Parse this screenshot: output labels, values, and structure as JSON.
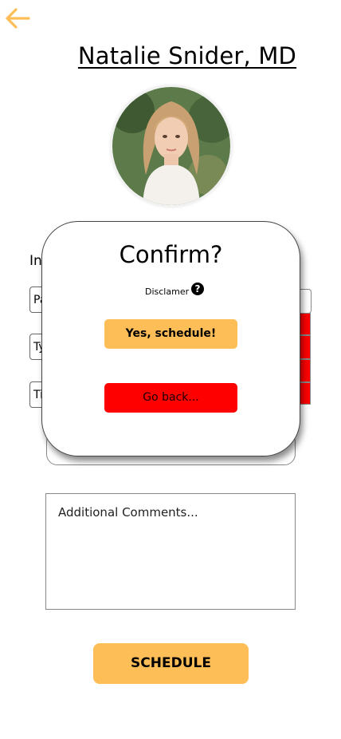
{
  "header": {
    "back_icon": "arrow-left-icon",
    "doctor_name": "Natalie Snider, MD",
    "accent_color": "#fdbe58"
  },
  "form": {
    "section_label": "In",
    "field_1_partial": "Pa",
    "field_2_partial": "Ty",
    "field_3_partial": "Ti",
    "comments_placeholder": "Additional Comments...",
    "schedule_label": "SCHEDULE"
  },
  "modal": {
    "title": "Confirm?",
    "disclaimer": "Disclamer",
    "help_icon": "question-circle-icon",
    "confirm_label": "Yes, schedule!",
    "cancel_label": "Go back...",
    "confirm_color": "#fdbe58",
    "cancel_color": "#ff0000"
  }
}
